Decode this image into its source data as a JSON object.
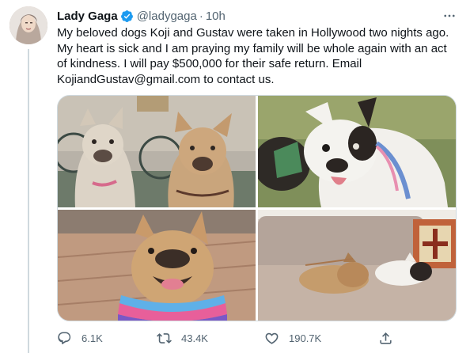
{
  "tweet": {
    "author_name": "Lady Gaga",
    "handle": "@ladygaga",
    "separator": "·",
    "time": "10h",
    "text": "My beloved dogs Koji and Gustav were taken in Hollywood two nights ago. My heart is sick and I am praying my family will be whole again with an act of kindness. I will pay $500,000 for their safe return. Email KojiandGustav@gmail.com to contact us."
  },
  "icons": {
    "avatar": "profile-photo",
    "verified": "verified-badge-icon",
    "more": "more-options-icon",
    "reply": "reply-icon",
    "retweet": "retweet-icon",
    "like": "heart-icon",
    "share": "share-icon"
  },
  "media": {
    "photos": [
      {
        "alt": "two french bulldogs sitting together outdoors"
      },
      {
        "alt": "white and black french bulldog with collar"
      },
      {
        "alt": "fawn french bulldog with rainbow collar smiling"
      },
      {
        "alt": "two french bulldogs sleeping on a couch"
      }
    ]
  },
  "stats": {
    "replies": "6.1K",
    "retweets": "43.4K",
    "likes": "190.7K"
  },
  "colors": {
    "text": "#0f1419",
    "secondary": "#536471",
    "verified": "#1d9bf0",
    "border": "#cfd9de"
  }
}
